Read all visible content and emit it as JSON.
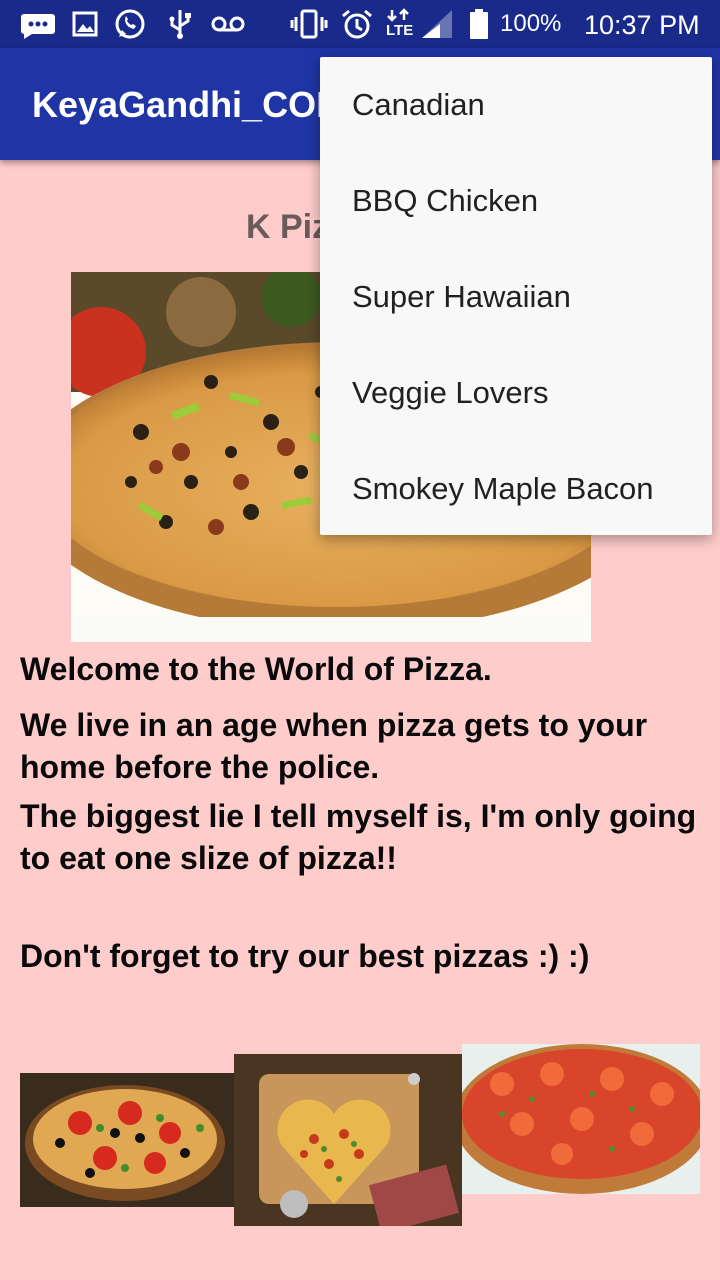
{
  "status_bar": {
    "icons": [
      "message-icon",
      "gallery-icon",
      "whatsapp-icon",
      "usb-icon",
      "voicemail-icon",
      "vibrate-icon",
      "alarm-icon",
      "lte-signal-icon",
      "battery-icon"
    ],
    "lte_label": "LTE",
    "battery_percent": "100%",
    "time": "10:37 PM"
  },
  "app_bar": {
    "title": "KeyaGandhi_COMP"
  },
  "main": {
    "heading": "K Pizza",
    "welcome": "Welcome to the World of Pizza.",
    "quote1": "We live in an age when pizza gets to your home before the police.",
    "quote2": "The biggest lie I tell myself is, I'm only going to eat one slize of pizza!!",
    "reminder": "Don't forget to try our best pizzas :) :)"
  },
  "menu": {
    "items": [
      "Canadian",
      "BBQ Chicken",
      "Super Hawaiian",
      "Veggie Lovers",
      "Smokey Maple Bacon"
    ]
  },
  "colors": {
    "status_bar": "#1a2a8a",
    "app_bar": "#1f35a5",
    "background": "#ffcccc",
    "menu_background": "#f8f8f8"
  }
}
